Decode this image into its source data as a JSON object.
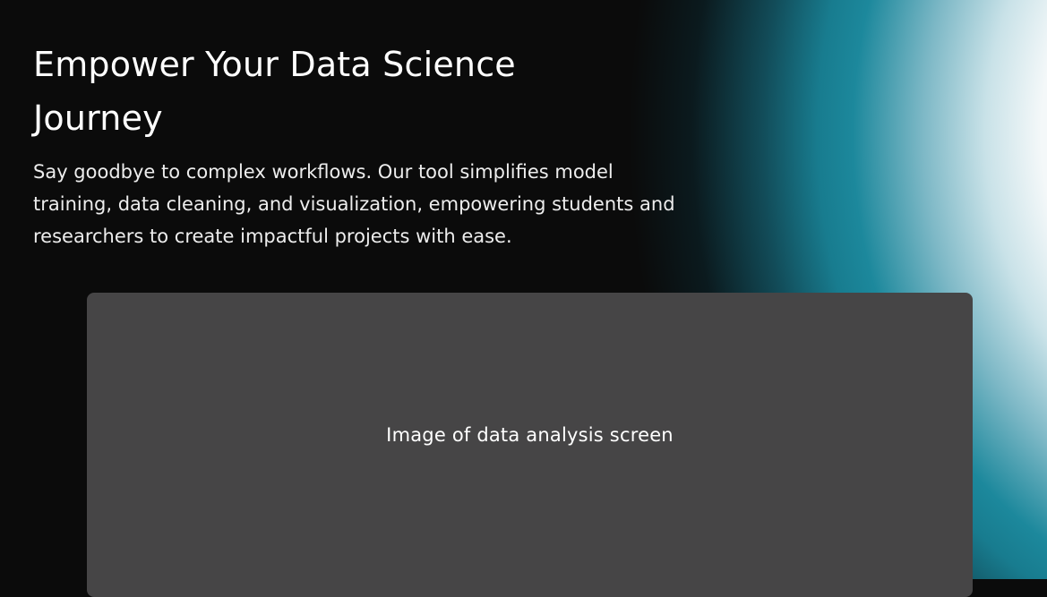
{
  "hero": {
    "title": "Empower Your Data Science Journey",
    "subtitle": "Say goodbye to complex workflows. Our tool simplifies model training, data cleaning, and visualization, empowering students and researchers to create impactful projects with ease."
  },
  "preview": {
    "caption": "Image of data analysis screen"
  },
  "colors": {
    "background": "#0b0b0b",
    "accent_teal": "#1c889c",
    "light_glow": "#f4f8f9",
    "placeholder_bg": "#464546",
    "text": "#ffffff"
  }
}
